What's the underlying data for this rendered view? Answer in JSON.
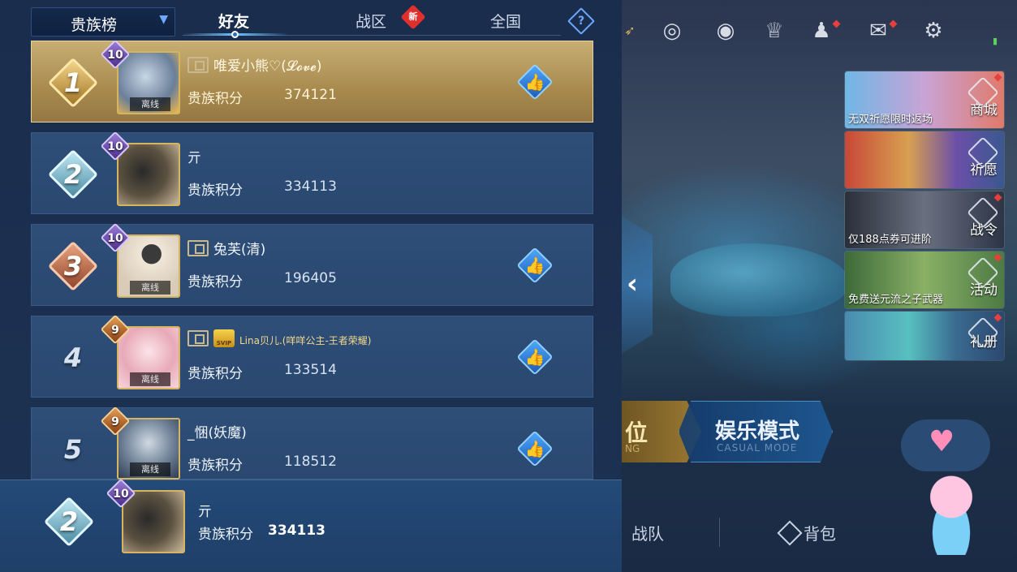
{
  "header": {
    "dropdown_label": "贵族榜",
    "tabs": [
      {
        "label": "好友",
        "active": true
      },
      {
        "label": "战区",
        "badge": "新"
      },
      {
        "label": "全国"
      }
    ],
    "help_symbol": "?"
  },
  "list": {
    "score_label": "贵族积分",
    "offline_label": "离线",
    "rows": [
      {
        "rank": "1",
        "level": "10",
        "name": "唯爱小熊♡(𝓛𝓸𝓿𝓮)",
        "score": "374121",
        "offline": true,
        "like": true,
        "badges": [
          "noble"
        ]
      },
      {
        "rank": "2",
        "level": "10",
        "name": "亓",
        "score": "334113",
        "offline": false,
        "like": false,
        "badges": []
      },
      {
        "rank": "3",
        "level": "10",
        "name": "兔芙(清)",
        "score": "196405",
        "offline": true,
        "like": true,
        "badges": [
          "noble"
        ]
      },
      {
        "rank": "4",
        "level": "9",
        "name": "Lina贝儿.(咩咩公主-王者荣耀)",
        "score": "133514",
        "offline": true,
        "like": true,
        "badges": [
          "noble",
          "svip"
        ],
        "svip_label": "SVIP"
      },
      {
        "rank": "5",
        "level": "9",
        "name": "_悃(妖魔)",
        "score": "118512",
        "offline": true,
        "like": true,
        "badges": []
      }
    ]
  },
  "self": {
    "rank": "2",
    "level": "10",
    "name": "亓",
    "score_label": "贵族积分",
    "score": "334113"
  },
  "game": {
    "side_menu": [
      {
        "caption": "无双祈愿限时返场",
        "label": "商城"
      },
      {
        "caption": "",
        "label": "祈愿"
      },
      {
        "caption": "仅188点券可进阶",
        "label": "战令"
      },
      {
        "caption": "免费送元流之子武器",
        "label": "活动"
      },
      {
        "caption": "",
        "label": "礼册"
      }
    ],
    "rank_mode": {
      "title": "位",
      "sub": "NG"
    },
    "casual_mode": {
      "title": "娱乐模式",
      "sub": "CASUAL MODE"
    },
    "bottom_nav": {
      "team": "战队",
      "bag": "背包"
    }
  },
  "colors": {
    "panel_bg": "#1b2d4d",
    "gold_row": "#c8ae74",
    "accent_blue": "#4da6ff",
    "new_badge": "#e0302e"
  },
  "icons": [
    "chevron-down-icon",
    "help-icon",
    "like-thumb-icon",
    "noble-card-icon",
    "svip-crown-icon",
    "settings-gear-icon",
    "mail-icon",
    "friends-icon",
    "trophy-icon",
    "eye-icon",
    "target-icon",
    "collapse-arrow-icon",
    "bag-icon",
    "heart-icon"
  ]
}
